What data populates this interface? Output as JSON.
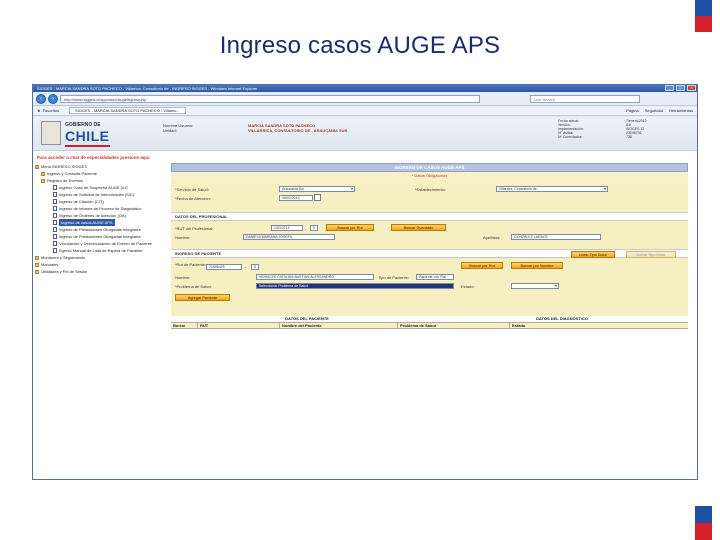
{
  "slide": {
    "title": "Ingreso casos AUGE APS"
  },
  "browser": {
    "title": "SIGGES - MARCIA SANDRA SOTO PACHECO - Villarrica, Consultorio de - INGRESO SIGGES - Windows Internet Explorer",
    "address": "http://www.sigges.cl/app/caso/AugeIngreso.jsp",
    "search_placeholder": "Live Search",
    "favorites_label": "Favoritos",
    "tab_label": "SIGGES - MARCIA SANDRA SOTO PACHECO - Villarric...",
    "tools": [
      "Página",
      "Seguridad",
      "Herramientas"
    ]
  },
  "header": {
    "logo_top": "GOBIERNO DE",
    "logo_main": "CHILE",
    "user_labels": [
      "Nombre Usuario:",
      "Unidad:"
    ],
    "user_values": [
      "MARCIA SANDRA SOTO PACHECO",
      "VILLARRICA, CONSULTORIO DE - ARAUCANÍA SUR"
    ],
    "meta_labels": [
      "Fecha actual:",
      "Versión:",
      "Implementación:",
      "Nº visitas:",
      "Nº Conectados:"
    ],
    "meta_values": [
      "7/enero/2012",
      "8.8",
      "SIGGES 12",
      "23098736",
      "738"
    ]
  },
  "back_link": "Para acceder a chat de especialidades presione aquí",
  "sidebar": [
    {
      "label": "Menú INGRESO SIGGES",
      "level": 1
    },
    {
      "label": "Ingreso y Consulta Paciente",
      "level": 2
    },
    {
      "label": "Registro de Eventos",
      "level": 2
    },
    {
      "label": "Ingreso Caso de Sospecha AUGE (o E",
      "level": 3
    },
    {
      "label": "Ingreso de Solicitud de Interconsulta (SIC)",
      "level": 3
    },
    {
      "label": "Ingreso de Citación (CIT)",
      "level": 3
    },
    {
      "label": "Ingreso de Informe de Proceso de Diagnóstico",
      "level": 3
    },
    {
      "label": "Ingreso de Órdenes de Atención (OA)",
      "level": 3
    },
    {
      "label": "Ingreso de casos AUGE APS",
      "level": 3,
      "selected": true
    },
    {
      "label": "Ingreso de Prestaciones Otorgadas Integrales",
      "level": 3
    },
    {
      "label": "Ingreso de Prestaciones Otorgadas Integrales",
      "level": 3
    },
    {
      "label": "Vinculación y Desvinculación de Evento de Paciente",
      "level": 3
    },
    {
      "label": "Egreso Manual de Lista de Espera de Paciente",
      "level": 3
    },
    {
      "label": "Monitoreo y Seguimiento",
      "level": 1
    },
    {
      "label": "Manuales",
      "level": 1
    },
    {
      "label": "Utilidades y Fin de Sesión",
      "level": 1
    }
  ],
  "form": {
    "title": "INGRESO DE CASOS AUGE APS",
    "required": "* Datos Obligatorios",
    "servicio_label": "*Servicio de Salud:",
    "servicio_value": "Araucanía Sur",
    "fecha_label": "*Fecha de Atención:",
    "fecha_value": "06/02/2012",
    "establecimiento_label": "*Establecimiento:",
    "establecimiento_value": "Villarrica, Consultorio de",
    "prof_section": "DATOS DEL PROFESIONAL",
    "rut_prof_label": "*RUT del Profesional:",
    "rut_prof_value": "13213714",
    "rut_prof_dv": "5",
    "btn_buscar_rut": "Buscar por Rut",
    "btn_buscar_guardado": "Buscar Guardado",
    "nombre_label": "Nombre:",
    "nombre_value": "DANIELA MARIANA JOSEFA",
    "apellidos_label": "Apellidos:",
    "apellidos_value": "GONZÁLEZ LARACE",
    "pac_section": "INGRESO DE PACIENTE",
    "btn_listar": "Listar Tipo Dolor",
    "btn_borrar_listar": "Borrar Tipo Dolor",
    "rut_pac_label": "*Rut de Paciente:",
    "rut_pac_value": "21895425",
    "rut_pac_dv": "5",
    "btn_buscar_rut_pac": "Buscar por Rut",
    "btn_buscar_nombre": "Buscar por Nombre",
    "nombre_pac_label": "Nombre:",
    "nombre_pac_value": "MORALES CATALINA BASTIAN ALESSANDRO",
    "tipo_pac_label": "Tipo de Paciente:",
    "tipo_pac_value": "Paciente con Rut",
    "problema_label": "*Problema de Salud:",
    "problema_value": "Seleccionar Problema de Salud",
    "estado_label": "Estado:",
    "estado_value": "",
    "btn_agregar": "Agregar Paciente",
    "table_group1": "DATOS DEL PACIENTE",
    "table_group2": "DATOS DEL DIAGNÓSTICO",
    "columns": [
      "Borrar",
      "RUT",
      "Nombre del Paciente",
      "Problema de Salud",
      "Estado"
    ]
  }
}
